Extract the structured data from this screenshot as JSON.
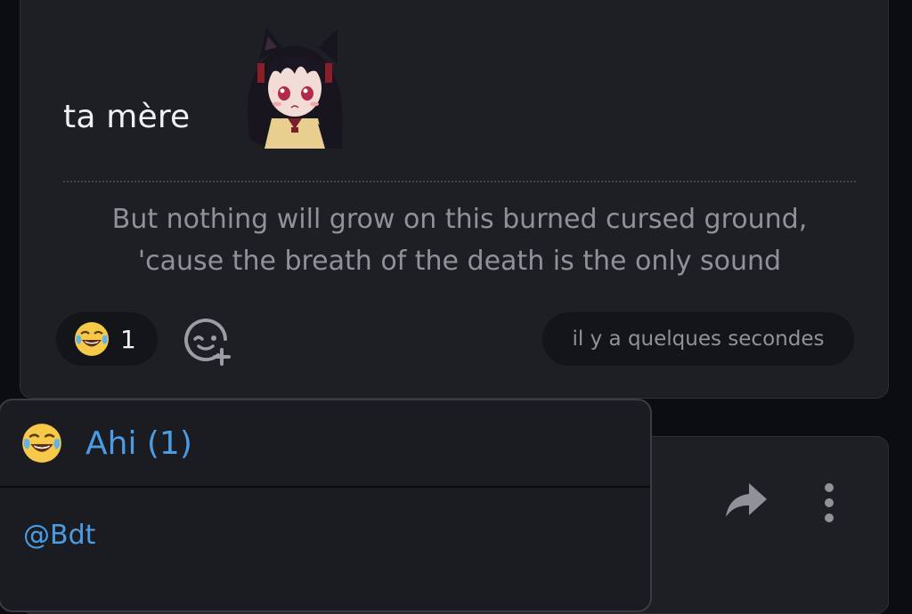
{
  "post": {
    "text": "ta mère",
    "sticker": "cat-girl-sticker",
    "signature": [
      "But nothing will grow on this burned cursed ground,",
      "'cause the breath of the death is the only sound"
    ],
    "reaction": {
      "emoji": "joy-emoji",
      "count": "1"
    },
    "add_reaction_icon": "add-reaction-icon",
    "timestamp": "il y a quelques secondes"
  },
  "next_post": {
    "share_icon": "share-icon",
    "more_icon": "more-vertical-icon"
  },
  "reaction_popup": {
    "emoji": "joy-emoji",
    "title": "Ahi (1)",
    "users": [
      "@Bdt"
    ]
  },
  "colors": {
    "background": "#0c0d10",
    "card": "#1e1f24",
    "pill": "#141519",
    "accent": "#4a9de4",
    "muted_text": "#8f9299"
  }
}
